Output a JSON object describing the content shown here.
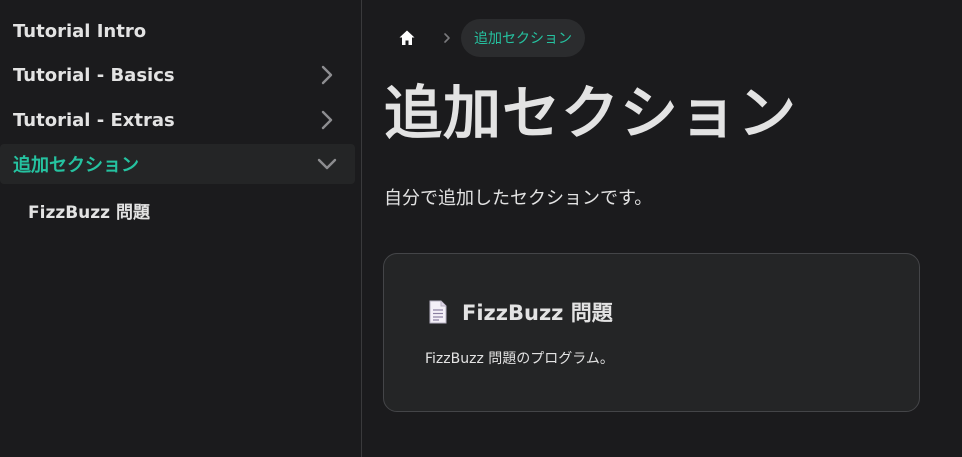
{
  "sidebar": {
    "items": [
      {
        "label": "Tutorial Intro",
        "has_children": false,
        "active": false
      },
      {
        "label": "Tutorial - Basics",
        "has_children": true,
        "active": false,
        "icon": "chevron-right-icon"
      },
      {
        "label": "Tutorial - Extras",
        "has_children": true,
        "active": false,
        "icon": "chevron-right-icon"
      },
      {
        "label": "追加セクション",
        "has_children": true,
        "active": true,
        "icon": "chevron-down-icon"
      }
    ],
    "sub_items": [
      {
        "label": "FizzBuzz 問題"
      }
    ]
  },
  "breadcrumb": {
    "home_icon": "home-icon",
    "separator_icon": "chevron-right-icon",
    "current": "追加セクション"
  },
  "page": {
    "title": "追加セクション",
    "description": "自分で追加したセクションです。"
  },
  "card": {
    "icon": "document-icon",
    "title": "FizzBuzz 問題",
    "description": "FizzBuzz 問題のプログラム。"
  },
  "colors": {
    "background": "#1b1b1d",
    "accent": "#25c2a0",
    "text": "#e3e3e3",
    "card_bg": "#242526",
    "border": "#444548"
  }
}
